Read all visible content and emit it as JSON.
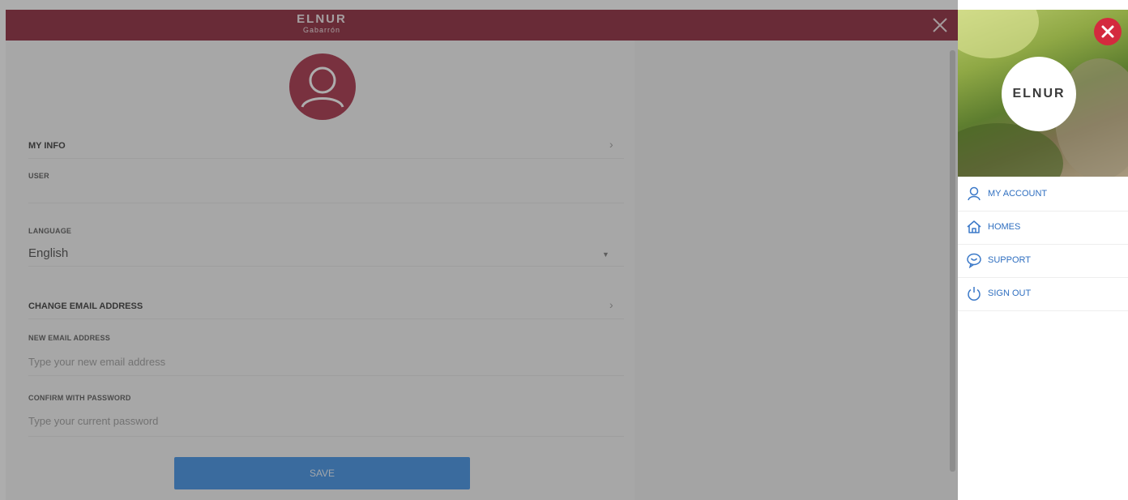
{
  "header": {
    "brand_main": "ELNUR",
    "brand_sub": "Gabarrón"
  },
  "form": {
    "my_info_title": "MY INFO",
    "user_label": "USER",
    "language_label": "LANGUAGE",
    "language_value": "English",
    "change_email_title": "CHANGE EMAIL ADDRESS",
    "new_email_label": "NEW EMAIL ADDRESS",
    "new_email_placeholder": "Type your new email address",
    "confirm_password_label": "CONFIRM WITH PASSWORD",
    "password_placeholder": "Type your current password",
    "save_label": "SAVE"
  },
  "side_menu": {
    "logo_text": "ELNUR",
    "items": [
      {
        "label": "MY ACCOUNT",
        "icon": "user-icon"
      },
      {
        "label": "HOMES",
        "icon": "home-icon"
      },
      {
        "label": "SUPPORT",
        "icon": "chat-icon"
      },
      {
        "label": "SIGN OUT",
        "icon": "power-icon"
      }
    ]
  },
  "colors": {
    "brand": "#8a1f35",
    "avatar": "#a62a42",
    "save_button": "#3a8ee6",
    "menu_text": "#2f6fc0",
    "close_badge": "#d42a3e"
  }
}
